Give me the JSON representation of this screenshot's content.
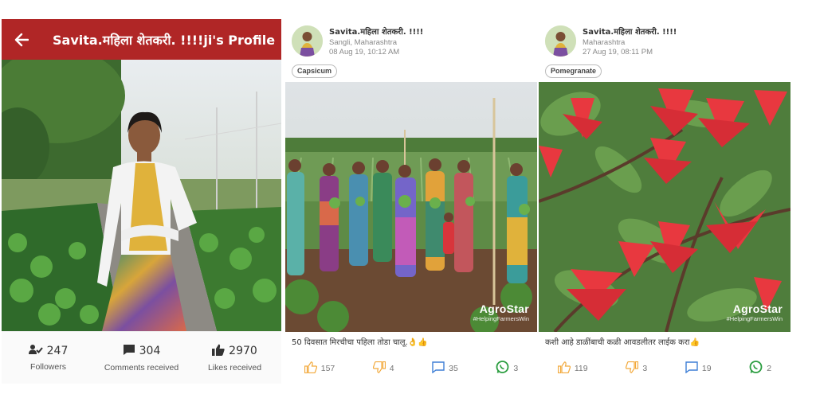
{
  "profile": {
    "title": "Savita.महिला शेतकरी. !!!!ji's Profile",
    "icons": {
      "back": "arrow-left-icon",
      "followers": "users-check-icon",
      "comments": "comment-icon",
      "likes": "thumbs-up-icon"
    },
    "stats": [
      {
        "value": "247",
        "label": "Followers"
      },
      {
        "value": "304",
        "label": "Comments received"
      },
      {
        "value": "2970",
        "label": "Likes received"
      }
    ]
  },
  "posts": [
    {
      "author": "Savita.महिला शेतकरी. !!!!",
      "location": "Sangli, Maharashtra",
      "timestamp": "08 Aug 19, 10:12 AM",
      "tag": "Capsicum",
      "caption": "50 दिवसात मिरचीचा पहिला तोडा चालू.👌👍",
      "watermark": {
        "brand": "AgroStar",
        "hashtag": "#HelpingFarmersWin"
      },
      "likes": "157",
      "dislikes": "4",
      "comments": "35",
      "shares": "3"
    },
    {
      "author": "Savita.महिला शेतकरी. !!!!",
      "location": "Maharashtra",
      "timestamp": "27 Aug 19, 08:11 PM",
      "tag": "Pomegranate",
      "caption": "कशी आहे डाळींबाची कळी आवडलीतर लाईक करा👍",
      "watermark": {
        "brand": "AgroStar",
        "hashtag": "#HelpingFarmersWin"
      },
      "likes": "119",
      "dislikes": "3",
      "comments": "19",
      "shares": "2"
    }
  ],
  "colors": {
    "header": "#b02626",
    "like": "#f2a93b",
    "comment": "#3f7fd6",
    "whatsapp": "#2a9d3f"
  }
}
